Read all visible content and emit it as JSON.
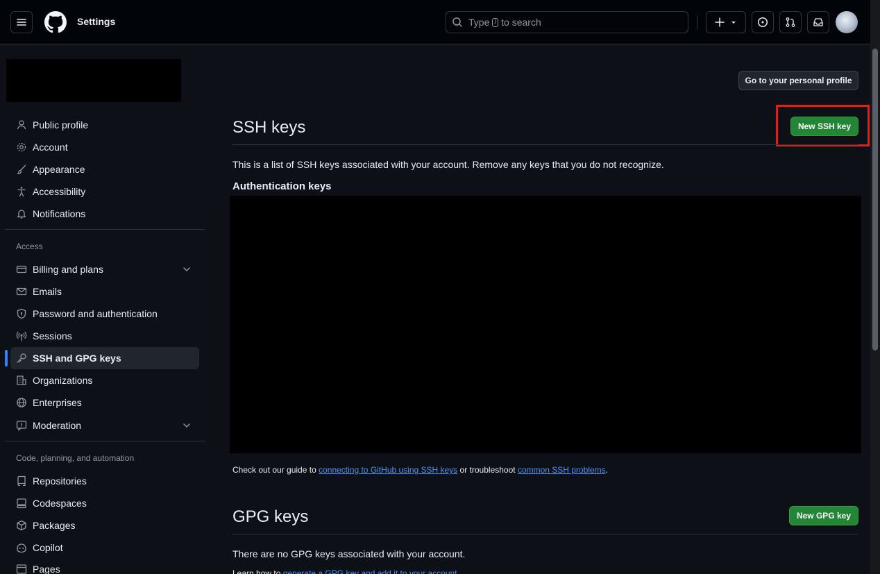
{
  "header": {
    "title": "Settings",
    "search_prefix": "Type",
    "search_key": "/",
    "search_suffix": "to search"
  },
  "sidebar": {
    "items_top": [
      {
        "label": "Public profile",
        "icon": "person-icon"
      },
      {
        "label": "Account",
        "icon": "gear-icon"
      },
      {
        "label": "Appearance",
        "icon": "paintbrush-icon"
      },
      {
        "label": "Accessibility",
        "icon": "accessibility-icon"
      },
      {
        "label": "Notifications",
        "icon": "bell-icon"
      }
    ],
    "section_access": "Access",
    "items_access": [
      {
        "label": "Billing and plans",
        "icon": "credit-card-icon"
      },
      {
        "label": "Emails",
        "icon": "mail-icon"
      },
      {
        "label": "Password and authentication",
        "icon": "shield-lock-icon"
      },
      {
        "label": "Sessions",
        "icon": "broadcast-icon"
      },
      {
        "label": "SSH and GPG keys",
        "icon": "key-icon"
      },
      {
        "label": "Organizations",
        "icon": "organization-icon"
      },
      {
        "label": "Enterprises",
        "icon": "globe-icon"
      },
      {
        "label": "Moderation",
        "icon": "report-icon"
      }
    ],
    "section_code": "Code, planning, and automation",
    "items_code": [
      {
        "label": "Repositories",
        "icon": "repo-icon"
      },
      {
        "label": "Codespaces",
        "icon": "codespaces-icon"
      },
      {
        "label": "Packages",
        "icon": "package-icon"
      },
      {
        "label": "Copilot",
        "icon": "copilot-icon"
      },
      {
        "label": "Pages",
        "icon": "browser-icon"
      }
    ]
  },
  "main": {
    "profile_button": "Go to your personal profile",
    "ssh": {
      "title": "SSH keys",
      "new_button": "New SSH key",
      "description": "This is a list of SSH keys associated with your account. Remove any keys that you do not recognize.",
      "auth_heading": "Authentication keys",
      "guide_prefix": "Check out our guide to",
      "guide_link1": "connecting to GitHub using SSH keys",
      "guide_middle": "or troubleshoot",
      "guide_link2": "common SSH problems",
      "guide_suffix": "."
    },
    "gpg": {
      "title": "GPG keys",
      "new_button": "New GPG key",
      "empty_text": "There are no GPG keys associated with your account.",
      "learn_prefix": "Learn how to",
      "learn_link": "generate a GPG key and add it to your account",
      "learn_suffix": "."
    }
  },
  "colors": {
    "accent": "#2f81f7",
    "green_button": "#238636",
    "highlight": "#e01f1f"
  }
}
